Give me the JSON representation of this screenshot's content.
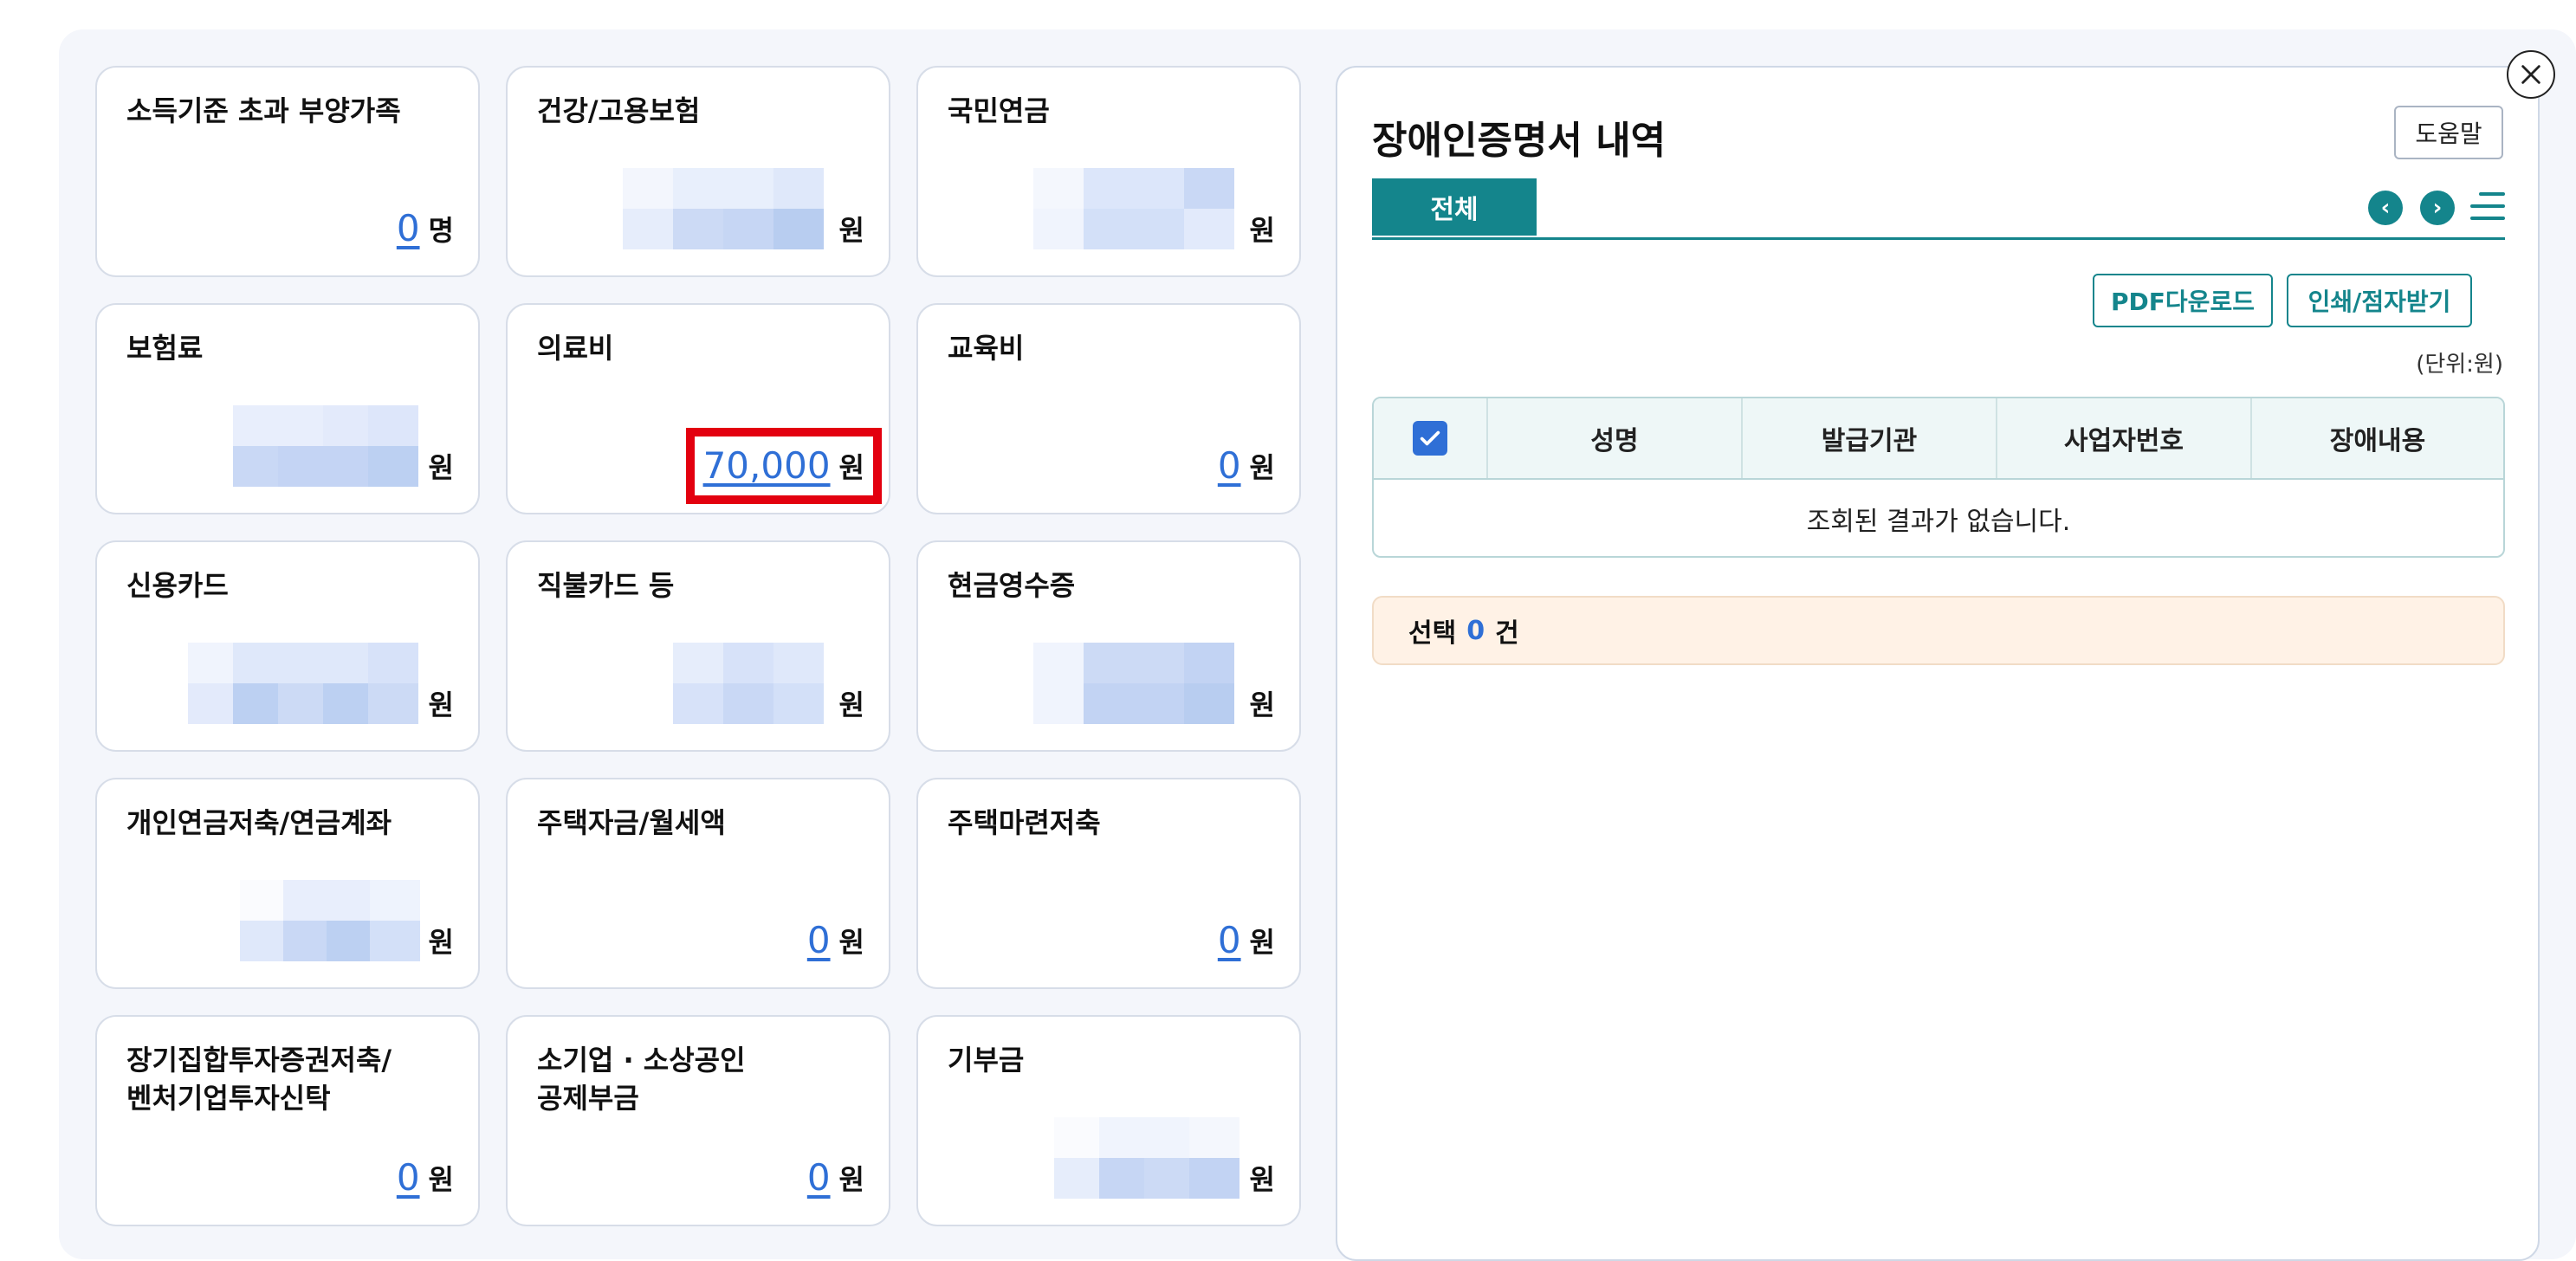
{
  "colors": {
    "accent": "#14858c",
    "link_blue": "#2f6fd6",
    "highlight": "#e3000f",
    "summary_bg": "#fff2e6"
  },
  "cards": [
    {
      "title": "소득기준 초과 부양가족",
      "value": "0",
      "unit": "명",
      "masked": false
    },
    {
      "title": "건강/고용보험",
      "value": "",
      "unit": "원",
      "masked": true
    },
    {
      "title": "국민연금",
      "value": "",
      "unit": "원",
      "masked": true
    },
    {
      "title": "보험료",
      "value": "",
      "unit": "원",
      "masked": true
    },
    {
      "title": "의료비",
      "value": "70,000",
      "unit": "원",
      "masked": false,
      "highlighted": true
    },
    {
      "title": "교육비",
      "value": "0",
      "unit": "원",
      "masked": false
    },
    {
      "title": "신용카드",
      "value": "",
      "unit": "원",
      "masked": true
    },
    {
      "title": "직불카드 등",
      "value": "",
      "unit": "원",
      "masked": true
    },
    {
      "title": "현금영수증",
      "value": "",
      "unit": "원",
      "masked": true
    },
    {
      "title": "개인연금저축/연금계좌",
      "value": "",
      "unit": "원",
      "masked": true
    },
    {
      "title": "주택자금/월세액",
      "value": "0",
      "unit": "원",
      "masked": false
    },
    {
      "title": "주택마련저축",
      "value": "0",
      "unit": "원",
      "masked": false
    },
    {
      "title": "장기집합투자증권저축/\n벤처기업투자신탁",
      "value": "0",
      "unit": "원",
      "masked": false
    },
    {
      "title": "소기업 · 소상공인\n공제부금",
      "value": "0",
      "unit": "원",
      "masked": false
    },
    {
      "title": "기부금",
      "value": "",
      "unit": "원",
      "masked": true
    }
  ],
  "detail": {
    "title": "장애인증명서 내역",
    "help_label": "도움말",
    "tab_all": "전체",
    "pdf_button": "PDF다운로드",
    "print_button": "인쇄/점자받기",
    "unit_note": "(단위:원)",
    "columns": [
      "성명",
      "발급기관",
      "사업자번호",
      "장애내용"
    ],
    "empty_message": "조회된 결과가 없습니다.",
    "summary_prefix": "선택",
    "summary_count": "0",
    "summary_suffix": "건"
  },
  "icons": {
    "close": "close-icon",
    "prev": "chevron-left-icon",
    "next": "chevron-right-icon",
    "menu": "hamburger-menu-icon",
    "check": "checkbox-checked-icon"
  }
}
